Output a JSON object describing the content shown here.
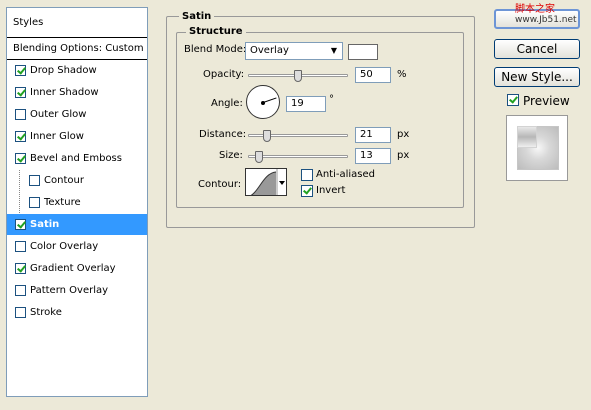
{
  "styles_panel": {
    "title": "Styles",
    "blending_options": "Blending Options: Custom",
    "items": [
      {
        "label": "Drop Shadow",
        "checked": true
      },
      {
        "label": "Inner Shadow",
        "checked": true
      },
      {
        "label": "Outer Glow",
        "checked": false
      },
      {
        "label": "Inner Glow",
        "checked": true
      },
      {
        "label": "Bevel and Emboss",
        "checked": true
      },
      {
        "label": "Contour",
        "checked": false
      },
      {
        "label": "Texture",
        "checked": false
      },
      {
        "label": "Satin",
        "checked": true,
        "selected": true
      },
      {
        "label": "Color Overlay",
        "checked": false
      },
      {
        "label": "Gradient Overlay",
        "checked": true
      },
      {
        "label": "Pattern Overlay",
        "checked": false
      },
      {
        "label": "Stroke",
        "checked": false
      }
    ]
  },
  "satin": {
    "group_title": "Satin",
    "structure_title": "Structure",
    "blend_mode_label": "Blend Mode:",
    "blend_mode_value": "Overlay",
    "opacity_label": "Opacity:",
    "opacity_value": "50",
    "opacity_unit": "%",
    "angle_label": "Angle:",
    "angle_value": "19",
    "angle_unit": "°",
    "distance_label": "Distance:",
    "distance_value": "21",
    "distance_unit": "px",
    "size_label": "Size:",
    "size_value": "13",
    "size_unit": "px",
    "contour_label": "Contour:",
    "anti_aliased_label": "Anti-aliased",
    "anti_aliased_checked": false,
    "invert_label": "Invert",
    "invert_checked": true
  },
  "buttons": {
    "ok_label": "",
    "cancel_label": "Cancel",
    "new_style_label": "New Style...",
    "preview_label": "Preview",
    "preview_checked": true
  },
  "watermark": {
    "line1": "脚本之家",
    "line2": "www.Jb51.net"
  }
}
